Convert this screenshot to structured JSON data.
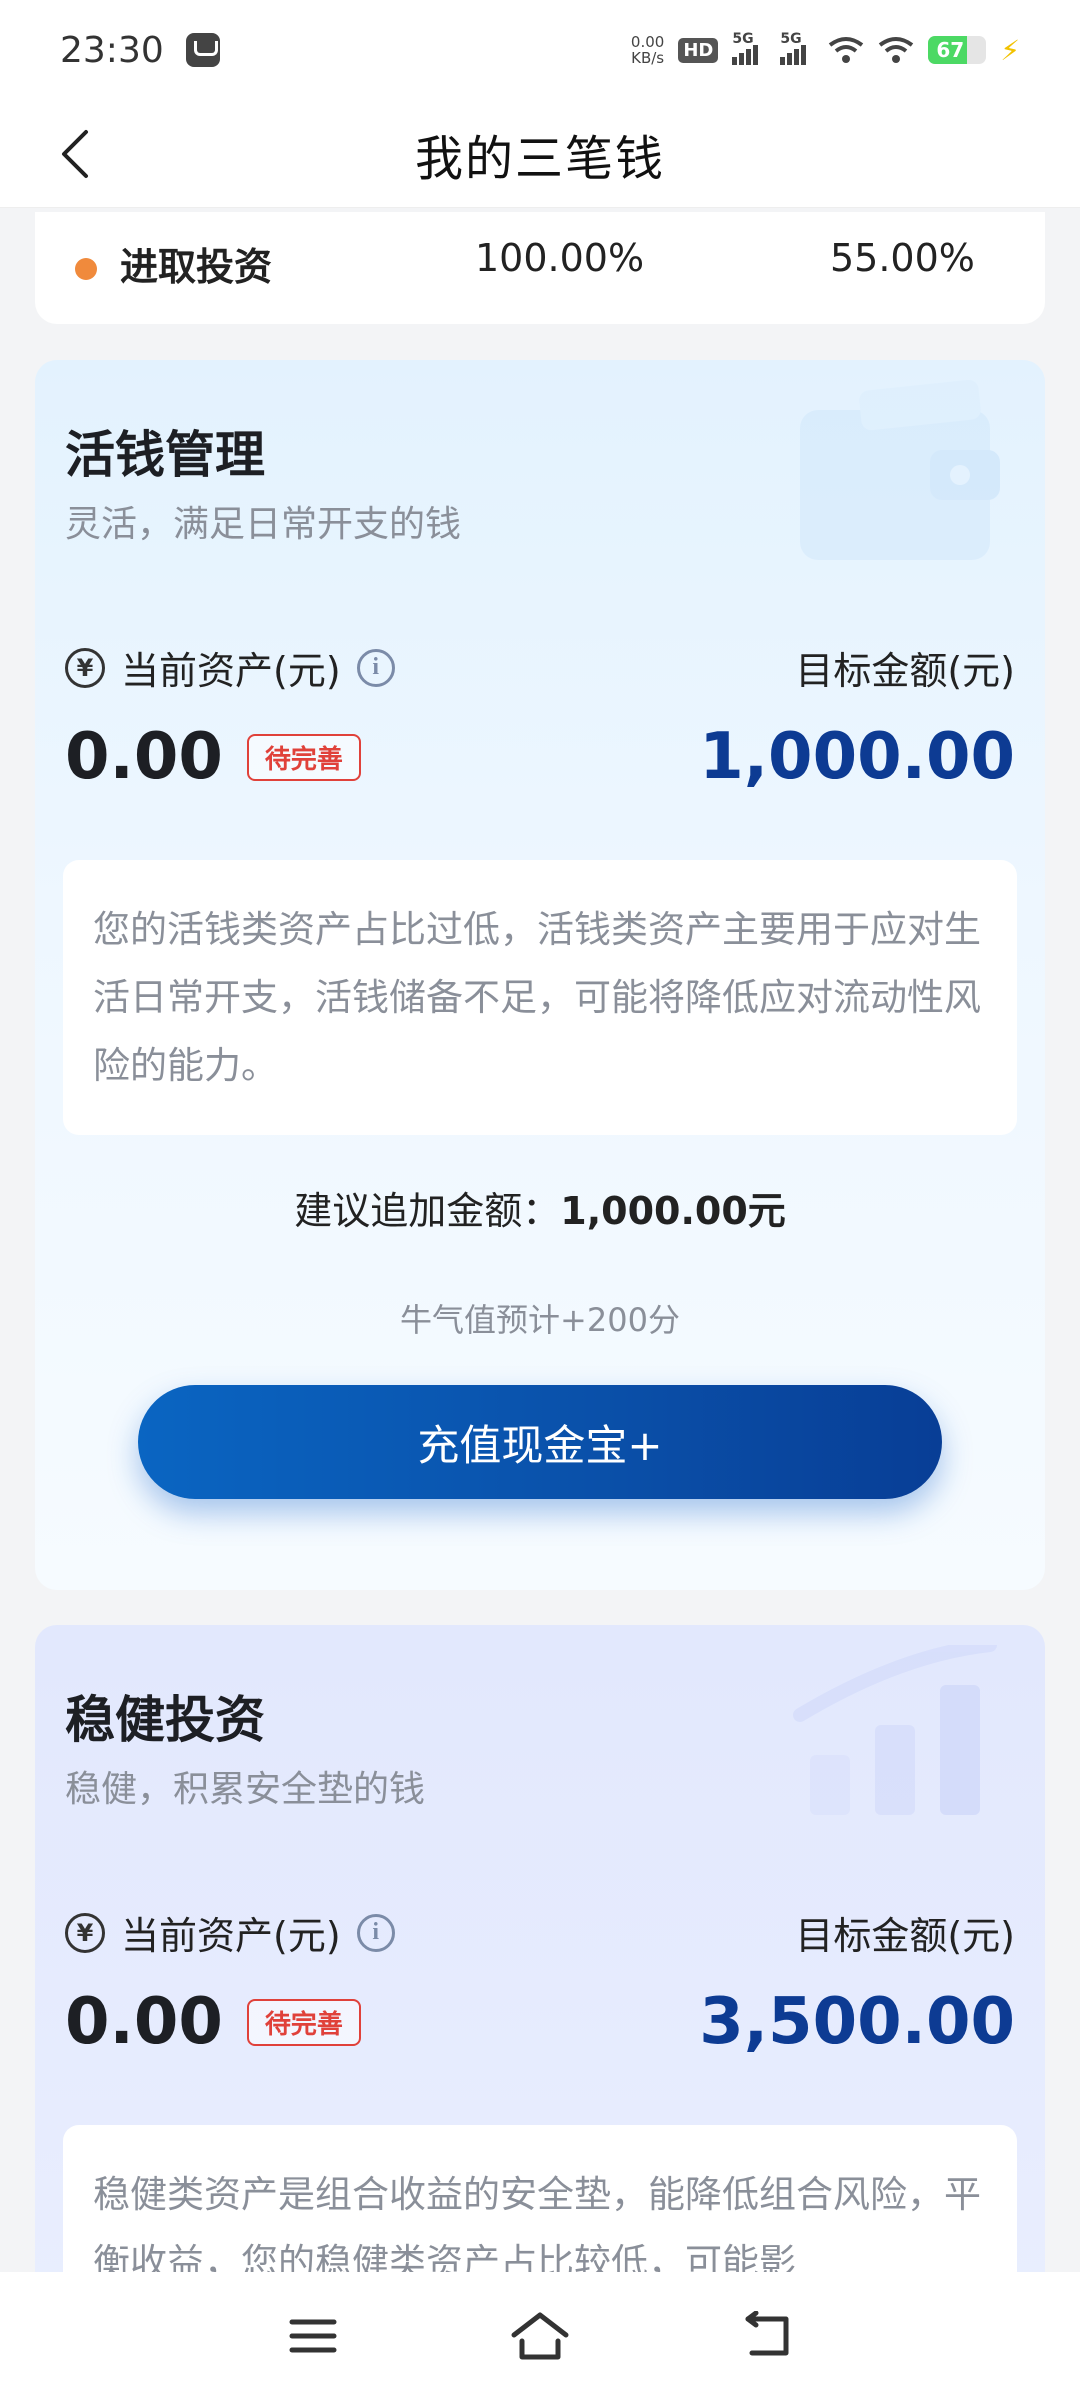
{
  "status_bar": {
    "time": "23:30",
    "net_speed_value": "0.00",
    "net_speed_unit": "KB/s",
    "hd_label": "HD",
    "sim1_label": "5G",
    "sim2_label": "5G",
    "battery_percent": "67",
    "battery_level": 0.67
  },
  "nav": {
    "title": "我的三笔钱"
  },
  "summary": {
    "label": "进取投资",
    "value1": "100.00%",
    "value2": "55.00%",
    "dot_color": "#f08a3c"
  },
  "cards": {
    "live": {
      "title": "活钱管理",
      "subtitle": "灵活，满足日常开支的钱",
      "current_label": "当前资产(元)",
      "target_label": "目标金额(元)",
      "current_value": "0.00",
      "badge": "待完善",
      "target_value": "1,000.00",
      "tip": "您的活钱类资产占比过低，活钱类资产主要用于应对生活日常开支，活钱储备不足，可能将降低应对流动性风险的能力。",
      "advice_label": "建议追加金额：",
      "advice_value": "1,000.00元",
      "points": "牛气值预计+200分",
      "cta": "充值现金宝+"
    },
    "steady": {
      "title": "稳健投资",
      "subtitle": "稳健，积累安全垫的钱",
      "current_label": "当前资产(元)",
      "target_label": "目标金额(元)",
      "current_value": "0.00",
      "badge": "待完善",
      "target_value": "3,500.00",
      "tip": "稳健类资产是组合收益的安全垫，能降低组合风险，平衡收益，您的稳健类资产占比较低，可能影"
    }
  },
  "colors": {
    "accent": "#0d3b93",
    "badge_red": "#e0413a",
    "button_blue": "#0a5bb8"
  }
}
